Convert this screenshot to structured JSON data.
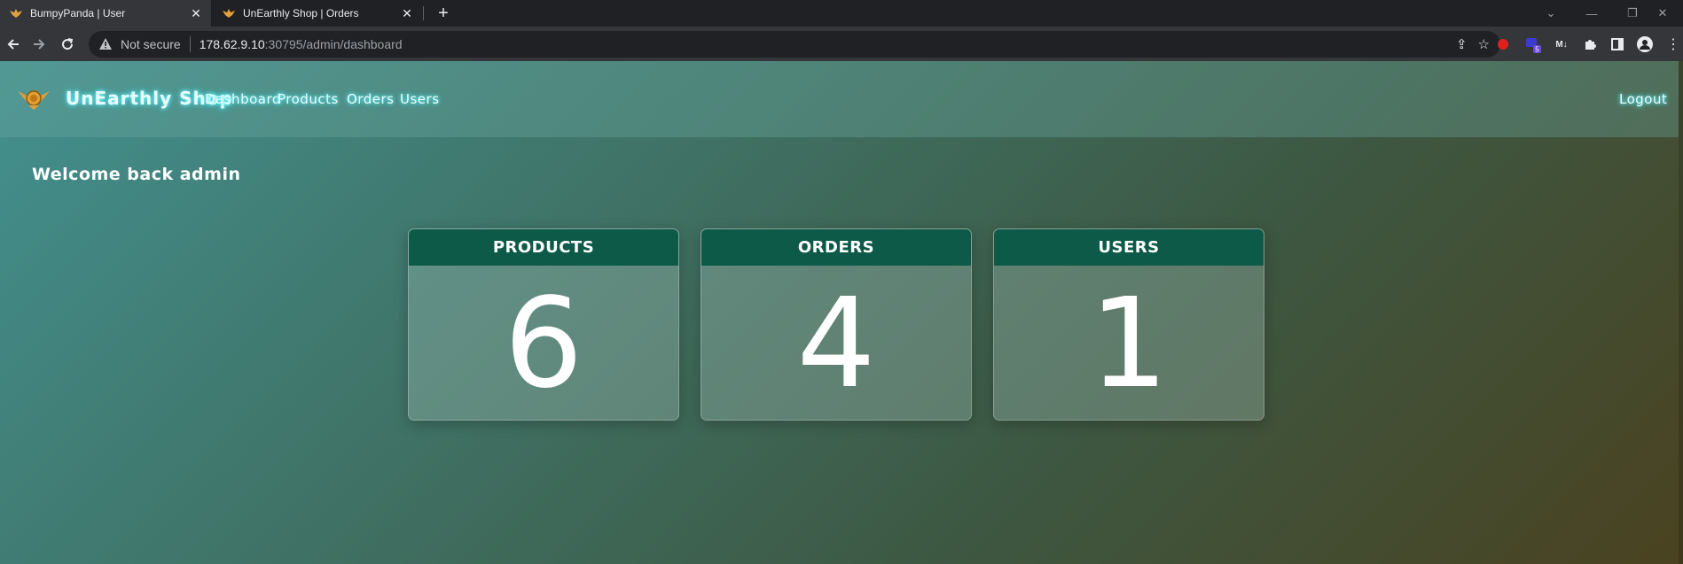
{
  "browser": {
    "tabs": [
      {
        "title": "BumpyPanda | User",
        "active": true
      },
      {
        "title": "UnEarthly Shop | Orders",
        "active": false
      }
    ],
    "address": {
      "security_label": "Not secure",
      "host": "178.62.9.10",
      "path": ":30795/admin/dashboard"
    },
    "extension_badge": "5",
    "extension_mh": "M↓"
  },
  "navbar": {
    "brand": "UnEarthly Shop",
    "links": [
      "Dashboard",
      "Products",
      "Orders",
      "Users"
    ],
    "logout": "Logout"
  },
  "main": {
    "welcome": "Welcome back admin",
    "cards": [
      {
        "title": "PRODUCTS",
        "value": "6"
      },
      {
        "title": "ORDERS",
        "value": "4"
      },
      {
        "title": "USERS",
        "value": "1"
      }
    ]
  },
  "colors": {
    "card_header": "#0e5a48",
    "neon_text": "#7ef9ff"
  }
}
